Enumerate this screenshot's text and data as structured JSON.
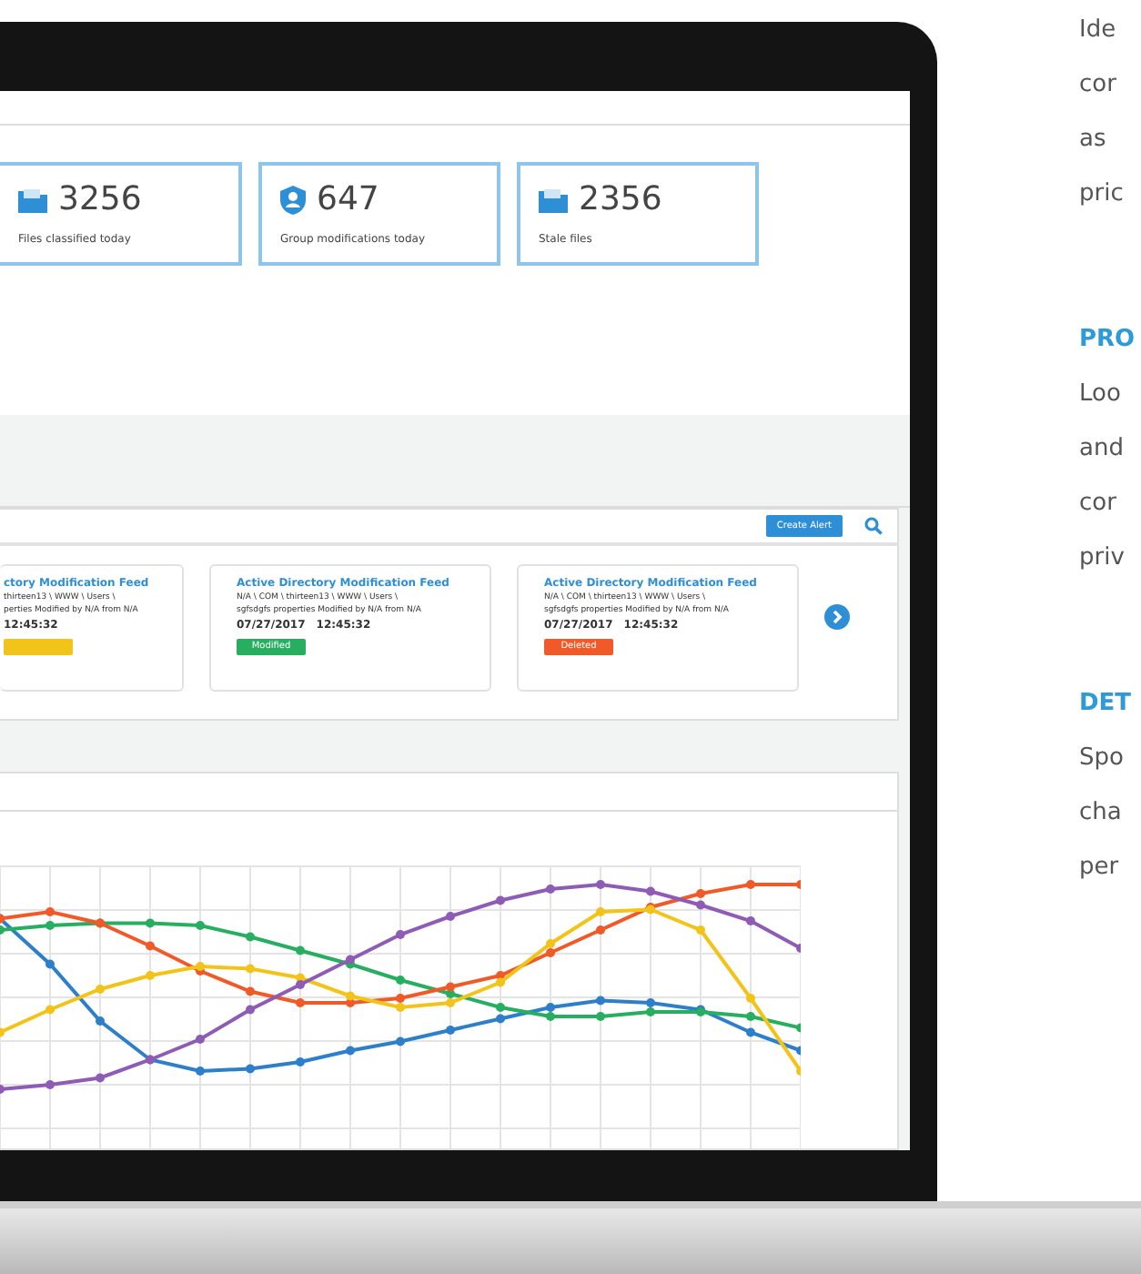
{
  "stats": [
    {
      "kind": "files",
      "value": "3256",
      "label": "Files classified today"
    },
    {
      "kind": "group",
      "value": "647",
      "label": "Group modifications today"
    },
    {
      "kind": "files",
      "value": "2356",
      "label": "Stale files"
    }
  ],
  "alerts": {
    "button": "Create Alert",
    "cards": [
      {
        "title": "ctory Modification Feed",
        "path": "thirteen13 \\ WWW \\ Users \\",
        "detail": "perties Modified by N/A from N/A",
        "time": "12:45:32",
        "color": "#f2c318"
      },
      {
        "title": "Active Directory Modification Feed",
        "path": "N/A \\ COM \\ thirteen13 \\ WWW \\ Users \\",
        "detail": "sgfsdgfs properties Modified by N/A from N/A",
        "date": "07/27/2017",
        "time": "12:45:32",
        "status": "Modified",
        "color": "#27ae60"
      },
      {
        "title": "Active Directory Modification Feed",
        "path": "N/A \\ COM \\ thirteen13 \\ WWW \\ Users \\",
        "detail": "sgfsdgfs properties Modified by N/A from N/A",
        "date": "07/27/2017",
        "time": "12:45:32",
        "status": "Deleted",
        "color": "#f05a28"
      }
    ]
  },
  "side_text": [
    {
      "lines": [
        "Ide",
        "cor",
        "as",
        "pric"
      ]
    },
    {
      "heading": "PRO",
      "lines": [
        "Loo",
        "and",
        "cor",
        "priv"
      ]
    },
    {
      "heading": "DET",
      "lines": [
        "Spo",
        "cha",
        "per"
      ]
    }
  ]
}
